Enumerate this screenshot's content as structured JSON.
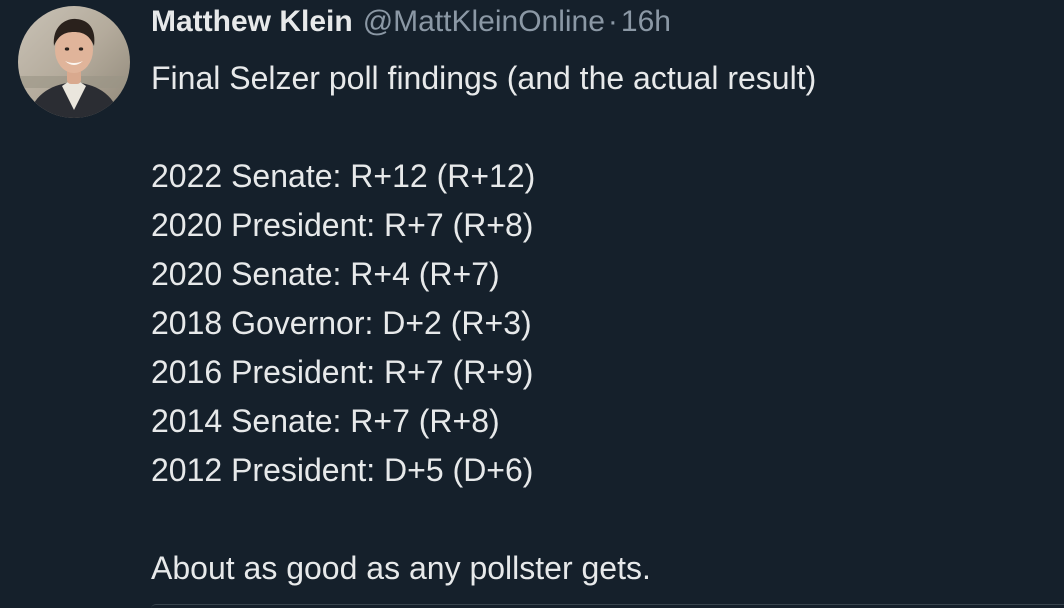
{
  "tweet": {
    "author_name": "Matthew Klein",
    "author_handle": "@MattKleinOnline",
    "separator": "·",
    "time": "16h",
    "intro": "Final Selzer poll findings (and the actual result)",
    "results": [
      "2022 Senate: R+12 (R+12)",
      "2020 President: R+7 (R+8)",
      "2020 Senate: R+4 (R+7)",
      "2018 Governor: D+2 (R+3)",
      "2016 President: R+7 (R+9)",
      "2014 Senate: R+7 (R+8)",
      "2012 President: D+5 (D+6)"
    ],
    "closing": "About as good as any pollster gets."
  },
  "colors": {
    "background": "#15202b",
    "primary_text": "#e7e9ea",
    "secondary_text": "#8b98a5"
  }
}
